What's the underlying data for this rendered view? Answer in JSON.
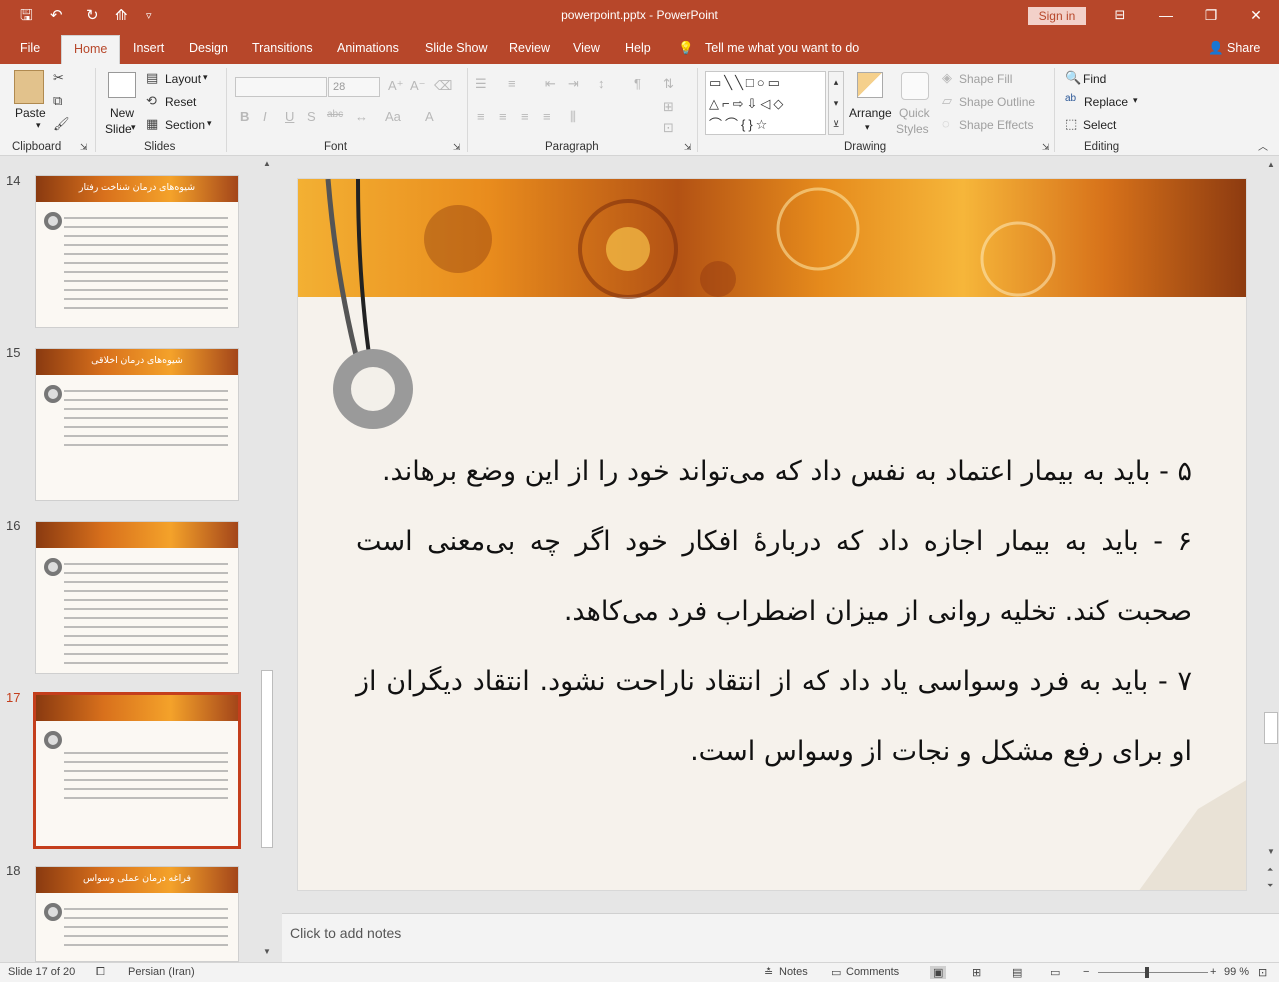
{
  "app": {
    "title": "powerpoint.pptx - PowerPoint",
    "signin": "Sign in"
  },
  "quick_access": {
    "save": "🖫",
    "undo": "↶",
    "redo": "↻",
    "present": "⟰",
    "customize": "▿"
  },
  "window": {
    "minimize": "—",
    "restore": "❐",
    "close": "✕",
    "ribbon_display": "⊟"
  },
  "menu": {
    "tabs": [
      "File",
      "Home",
      "Insert",
      "Design",
      "Transitions",
      "Animations",
      "Slide Show",
      "Review",
      "View",
      "Help"
    ],
    "tellme": "Tell me what you want to do",
    "share": "Share"
  },
  "ribbon": {
    "clipboard": {
      "label": "Clipboard",
      "paste": "Paste"
    },
    "slides": {
      "label": "Slides",
      "new_slide": "New",
      "new_slide2": "Slide",
      "layout": "Layout",
      "reset": "Reset",
      "section": "Section"
    },
    "font": {
      "label": "Font",
      "size": "28",
      "bold": "B",
      "italic": "I",
      "underline": "U",
      "strike": "S",
      "spacing": "abc",
      "grow": "A",
      "case": "Aa",
      "color": "A"
    },
    "paragraph": {
      "label": "Paragraph"
    },
    "drawing": {
      "label": "Drawing",
      "arrange": "Arrange",
      "quick_styles": "Quick",
      "quick_styles2": "Styles",
      "shape_fill": "Shape Fill",
      "shape_outline": "Shape Outline",
      "shape_effects": "Shape Effects"
    },
    "editing": {
      "label": "Editing",
      "find": "Find",
      "replace": "Replace",
      "select": "Select"
    }
  },
  "thumbnails": [
    {
      "num": "14",
      "title": "شیوه‌های درمان شناخت رفتار"
    },
    {
      "num": "15",
      "title": "شیوه‌های درمان اخلاقی"
    },
    {
      "num": "16",
      "title": ""
    },
    {
      "num": "17",
      "title": ""
    },
    {
      "num": "18",
      "title": "فراغه درمان عملی وسواس"
    }
  ],
  "slide": {
    "line1": "۵ - باید به بیمار اعتماد به نفس داد که می‌تواند خود را از این وضع برهاند.",
    "line2": "۶ - باید به بیمار اجازه داد که دربارۀ افکار خود اگر چه بی‌معنی است صحبت کند. تخلیه روانی از میزان اضطراب فرد می‌کاهد.",
    "line3": "۷ - باید به فرد وسواسی یاد داد که از انتقاد ناراحت نشود. انتقاد دیگران از او برای رفع مشکل و نجات از وسواس است."
  },
  "notes": {
    "placeholder": "Click to add notes"
  },
  "status": {
    "slide": "Slide 17 of 20",
    "language": "Persian (Iran)",
    "notes": "Notes",
    "comments": "Comments",
    "zoom": "99 %",
    "zoom_minus": "−",
    "zoom_plus": "+"
  }
}
